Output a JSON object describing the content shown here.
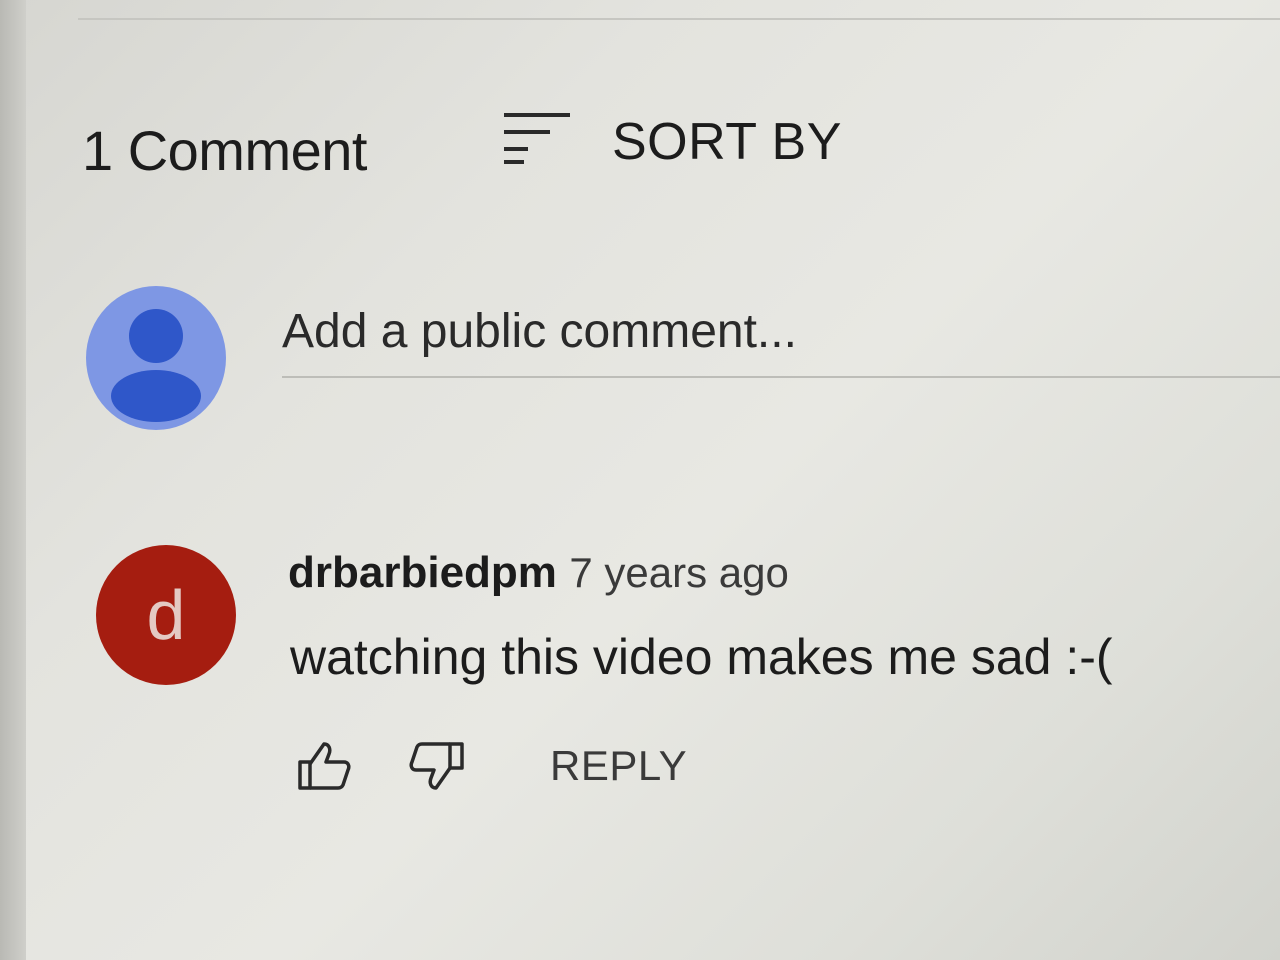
{
  "comments_header": {
    "count_label": "1 Comment",
    "sort_label": "SORT BY",
    "sort_icon": "sort-icon"
  },
  "compose": {
    "placeholder": "Add a public comment...",
    "avatar_icon": "person-icon",
    "avatar_color": "#7e97e4",
    "avatar_figure_color": "#2f57c9"
  },
  "comments": [
    {
      "avatar_letter": "d",
      "avatar_color": "#a51d10",
      "author": "drbarbiedpm",
      "time": "7 years ago",
      "text": "watching this video makes me sad :-(",
      "actions": {
        "like_icon": "thumbs-up-icon",
        "dislike_icon": "thumbs-down-icon",
        "reply_label": "REPLY"
      }
    }
  ]
}
